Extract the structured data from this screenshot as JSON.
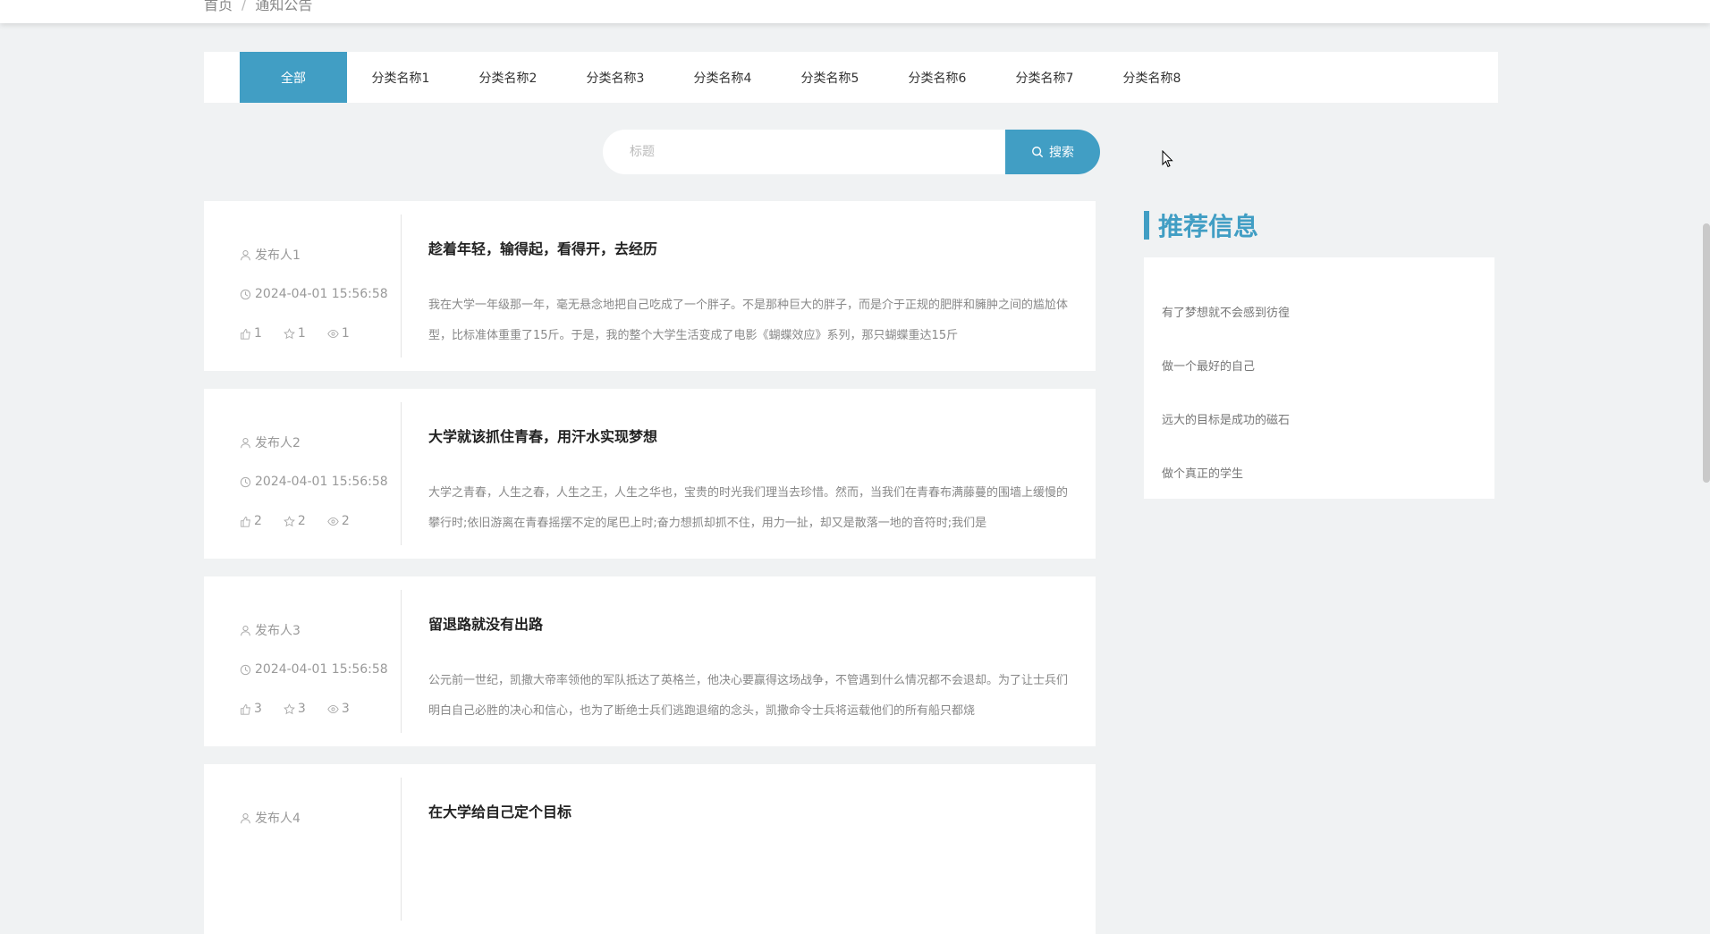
{
  "breadcrumb": {
    "home": "首页",
    "separator": "/",
    "current": "通知公告"
  },
  "tabs": [
    {
      "label": "全部",
      "active": true
    },
    {
      "label": "分类名称1"
    },
    {
      "label": "分类名称2"
    },
    {
      "label": "分类名称3"
    },
    {
      "label": "分类名称4"
    },
    {
      "label": "分类名称5"
    },
    {
      "label": "分类名称6"
    },
    {
      "label": "分类名称7"
    },
    {
      "label": "分类名称8"
    }
  ],
  "search": {
    "placeholder": "标题",
    "button_label": "搜索",
    "button_icon": "search-icon"
  },
  "articles": [
    {
      "author": "发布人1",
      "date": "2024-04-01 15:56:58",
      "likes": "1",
      "favorites": "1",
      "views": "1",
      "title": "趁着年轻，输得起，看得开，去经历",
      "excerpt": "我在大学一年级那一年，毫无悬念地把自己吃成了一个胖子。不是那种巨大的胖子，而是介于正规的肥胖和臃肿之间的尴尬体型，比标准体重重了15斤。于是，我的整个大学生活变成了电影《蝴蝶效应》系列，那只蝴蝶重达15斤"
    },
    {
      "author": "发布人2",
      "date": "2024-04-01 15:56:58",
      "likes": "2",
      "favorites": "2",
      "views": "2",
      "title": "大学就该抓住青春，用汗水实现梦想",
      "excerpt": "大学之青春，人生之春，人生之王，人生之华也，宝贵的时光我们理当去珍惜。然而，当我们在青春布满藤蔓的围墙上缓慢的攀行时;依旧游离在青春摇摆不定的尾巴上时;奋力想抓却抓不住，用力一扯，却又是散落一地的音符时;我们是"
    },
    {
      "author": "发布人3",
      "date": "2024-04-01 15:56:58",
      "likes": "3",
      "favorites": "3",
      "views": "3",
      "title": "留退路就没有出路",
      "excerpt": "公元前一世纪，凯撒大帝率领他的军队抵达了英格兰，他决心要赢得这场战争，不管遇到什么情况都不会退却。为了让士兵们明白自己必胜的决心和信心，也为了断绝士兵们逃跑退缩的念头，凯撒命令士兵将运载他们的所有船只都烧"
    },
    {
      "author": "发布人4",
      "date": "",
      "likes": "",
      "favorites": "",
      "views": "",
      "title": "在大学给自己定个目标",
      "excerpt": ""
    }
  ],
  "recommend": {
    "title": "推荐信息",
    "items": [
      "有了梦想就不会感到彷徨",
      "做一个最好的自己",
      "远大的目标是成功的磁石",
      "做个真正的学生"
    ]
  },
  "colors": {
    "accent": "#419ec4",
    "page_bg": "#f0f2f3"
  }
}
